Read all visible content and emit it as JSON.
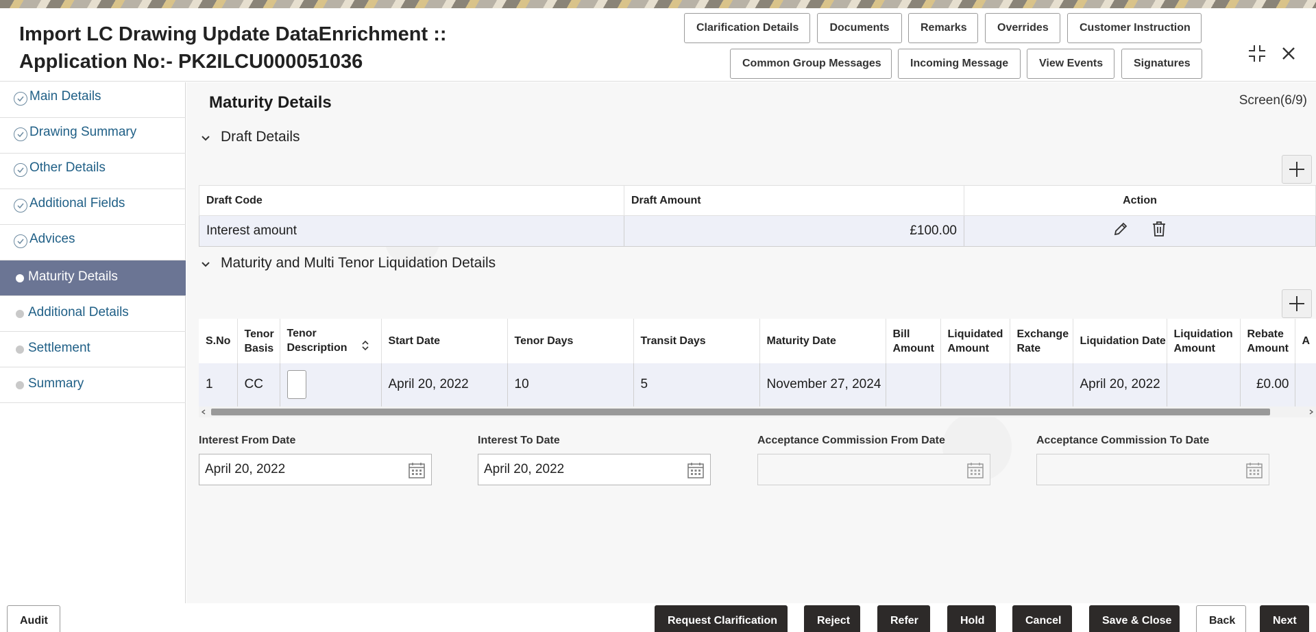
{
  "header": {
    "title_line1": "Import LC Drawing Update DataEnrichment ::",
    "title_line2": "Application No:- PK2ILCU000051036",
    "buttons_row1": [
      "Clarification Details",
      "Documents",
      "Remarks",
      "Overrides",
      "Customer Instruction"
    ],
    "buttons_row2": [
      "Common Group Messages",
      "Incoming Message",
      "View Events",
      "Signatures"
    ]
  },
  "sidebar": {
    "items": [
      {
        "label": "Main Details",
        "state": "done"
      },
      {
        "label": "Drawing Summary",
        "state": "done"
      },
      {
        "label": "Other Details",
        "state": "done"
      },
      {
        "label": "Additional Fields",
        "state": "done"
      },
      {
        "label": "Advices",
        "state": "done"
      },
      {
        "label": "Maturity Details",
        "state": "active"
      },
      {
        "label": "Additional Details",
        "state": "pending"
      },
      {
        "label": "Settlement",
        "state": "pending"
      },
      {
        "label": "Summary",
        "state": "pending"
      }
    ]
  },
  "main": {
    "title": "Maturity Details",
    "screen": "Screen(6/9)",
    "draft_section": {
      "title": "Draft Details",
      "columns": [
        "Draft Code",
        "Draft Amount",
        "Action"
      ],
      "rows": [
        {
          "code": "Interest amount",
          "amount": "£100.00"
        }
      ]
    },
    "maturity_section": {
      "title": "Maturity and Multi Tenor Liquidation Details",
      "columns": [
        "S.No",
        "Tenor Basis",
        "Tenor Description",
        "Start Date",
        "Tenor Days",
        "Transit Days",
        "Maturity Date",
        "Bill Amount",
        "Liquidated Amount",
        "Exchange Rate",
        "Liquidation Date",
        "Liquidation Amount",
        "Rebate Amount",
        "A"
      ],
      "rows": [
        {
          "sno": "1",
          "tenor_basis": "CC",
          "tenor_description": "",
          "start_date": "April 20, 2022",
          "tenor_days": "10",
          "transit_days": "5",
          "maturity_date": "November 27, 2024",
          "bill_amount": "",
          "liquidated_amount": "",
          "exchange_rate": "",
          "liquidation_date": "April 20, 2022",
          "liquidation_amount": "",
          "rebate_amount": "£0.00"
        }
      ]
    },
    "fields": {
      "interest_from_label": "Interest From Date",
      "interest_from_value": "April 20, 2022",
      "interest_to_label": "Interest To Date",
      "interest_to_value": "April 20, 2022",
      "acceptance_from_label": "Acceptance Commission From Date",
      "acceptance_from_value": "",
      "acceptance_to_label": "Acceptance Commission To Date",
      "acceptance_to_value": ""
    }
  },
  "footer": {
    "audit": "Audit",
    "buttons": [
      "Request Clarification",
      "Reject",
      "Refer",
      "Hold",
      "Cancel",
      "Save & Close",
      "Back",
      "Next"
    ]
  }
}
